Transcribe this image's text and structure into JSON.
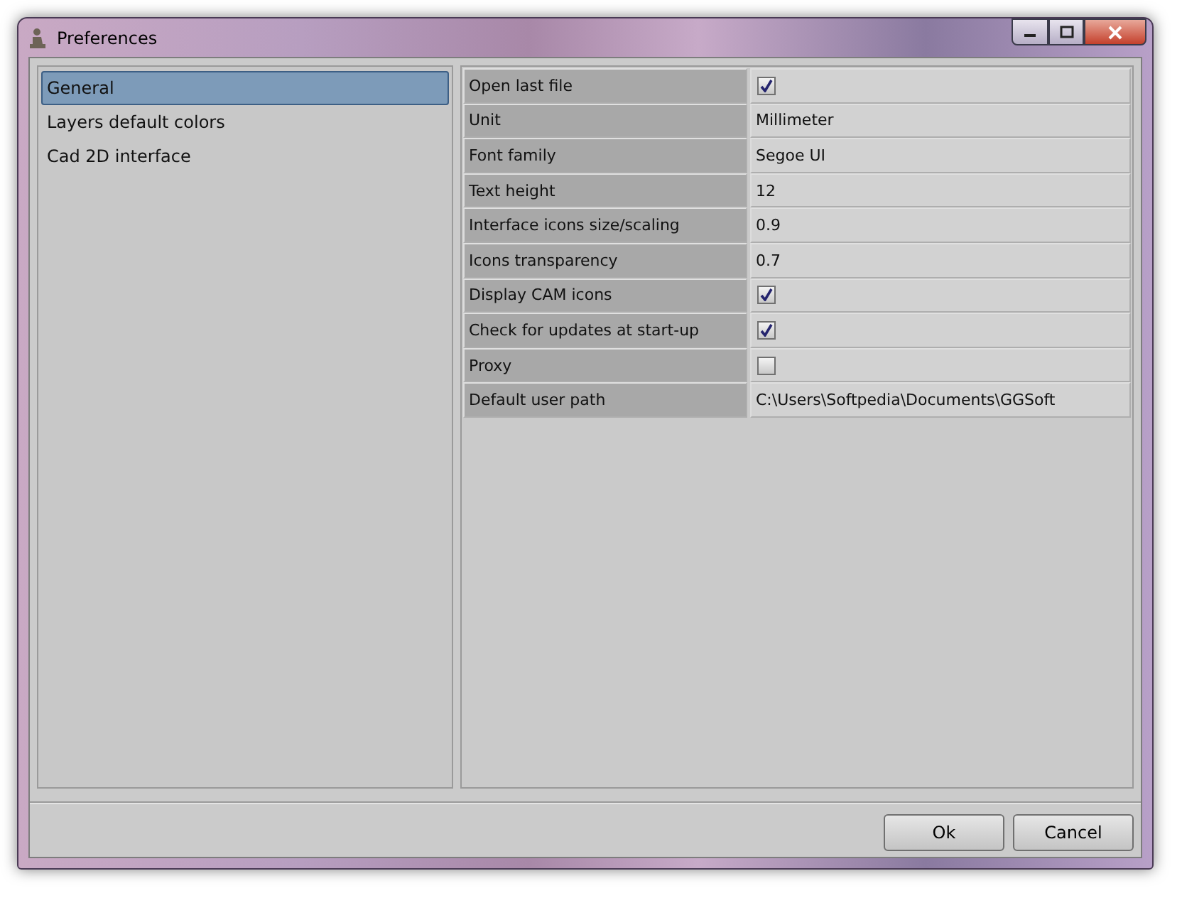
{
  "window": {
    "title": "Preferences"
  },
  "sidebar": {
    "items": [
      {
        "label": "General",
        "selected": true
      },
      {
        "label": "Layers default colors",
        "selected": false
      },
      {
        "label": "Cad 2D interface",
        "selected": false
      }
    ]
  },
  "properties": [
    {
      "name": "Open last file",
      "kind": "checkbox",
      "checked": true
    },
    {
      "name": "Unit",
      "kind": "text",
      "value": "Millimeter"
    },
    {
      "name": "Font family",
      "kind": "text",
      "value": "Segoe UI"
    },
    {
      "name": "Text height",
      "kind": "text",
      "value": "12"
    },
    {
      "name": "Interface icons size/scaling",
      "kind": "text",
      "value": "0.9"
    },
    {
      "name": "Icons transparency",
      "kind": "text",
      "value": "0.7"
    },
    {
      "name": "Display CAM icons",
      "kind": "checkbox",
      "checked": true
    },
    {
      "name": "Check for updates at start-up",
      "kind": "checkbox",
      "checked": true
    },
    {
      "name": "Proxy",
      "kind": "checkbox",
      "checked": false
    },
    {
      "name": "Default user path",
      "kind": "text",
      "value": "C:\\Users\\Softpedia\\Documents\\GGSoft"
    }
  ],
  "buttons": [
    "Ok",
    "Cancel"
  ]
}
